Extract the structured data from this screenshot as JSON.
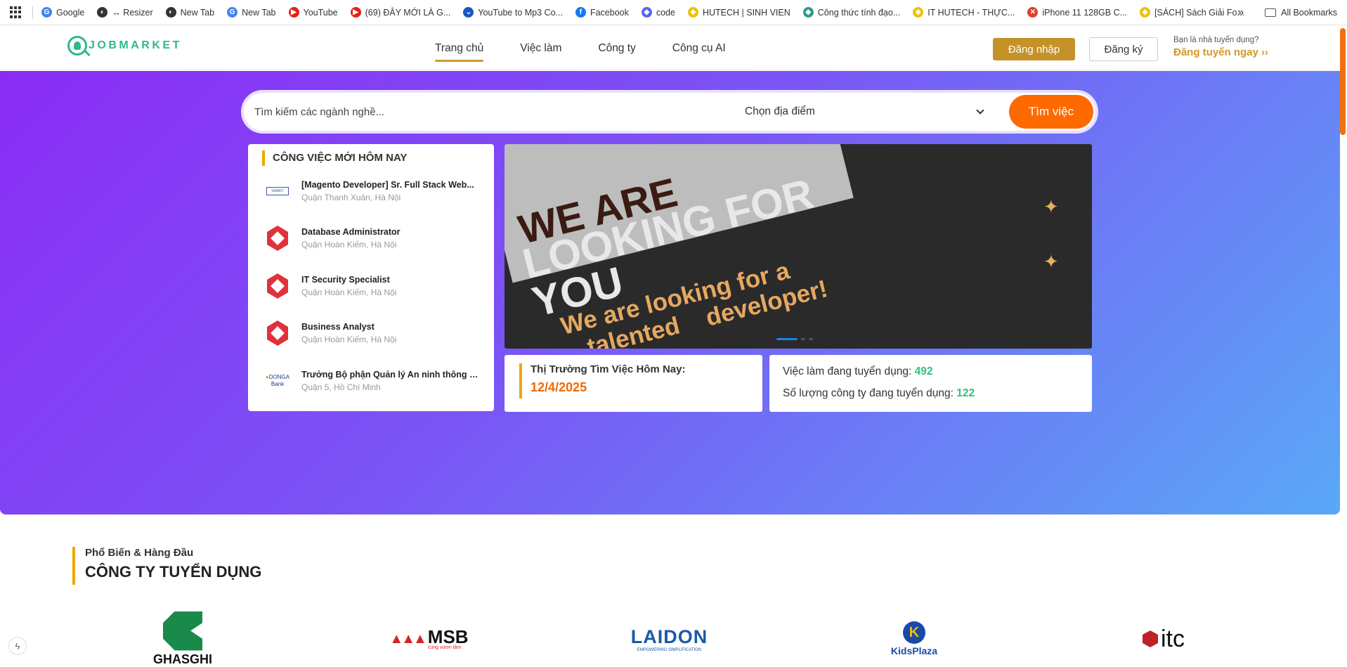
{
  "bookmarks": [
    {
      "label": "Google",
      "color": "#4285f4",
      "glyph": "G"
    },
    {
      "label": "↔ Resizer",
      "color": "#333",
      "glyph": "◐"
    },
    {
      "label": "New Tab",
      "color": "#333",
      "glyph": "◐"
    },
    {
      "label": "New Tab",
      "color": "#4285f4",
      "glyph": "G"
    },
    {
      "label": "YouTube",
      "color": "#e62117",
      "glyph": "▶"
    },
    {
      "label": "(69) ĐÂY MỚI LÀ G...",
      "color": "#e62117",
      "glyph": "▶"
    },
    {
      "label": "YouTube to Mp3 Co...",
      "color": "#1a56c4",
      "glyph": "⌄"
    },
    {
      "label": "Facebook",
      "color": "#1877f2",
      "glyph": "f"
    },
    {
      "label": "code",
      "color": "#5865f2",
      "glyph": "◆"
    },
    {
      "label": "HUTECH | SINH VIEN",
      "color": "#f0c000",
      "glyph": "◆"
    },
    {
      "label": "Công thức tính đạo...",
      "color": "#2a9d8f",
      "glyph": "◆"
    },
    {
      "label": "IT HUTECH - THỰC...",
      "color": "#f0c000",
      "glyph": "◆"
    },
    {
      "label": "iPhone 11 128GB C...",
      "color": "#e0402a",
      "glyph": "✕"
    },
    {
      "label": "[SÁCH] Sách Giải Fo...",
      "color": "#f0c000",
      "glyph": "◆"
    }
  ],
  "bookmarks_more": "»",
  "all_bookmarks": "All Bookmarks",
  "header": {
    "logo_text": "JOBMARKET",
    "nav": [
      {
        "label": "Trang chủ",
        "active": true
      },
      {
        "label": "Việc làm"
      },
      {
        "label": "Công ty"
      },
      {
        "label": "Công cụ AI"
      }
    ],
    "login": "Đăng nhập",
    "register": "Đăng ký",
    "recruiter_question": "Bạn là nhà tuyển dụng?",
    "recruiter_cta": "Đăng tuyển ngay",
    "recruiter_arrow": "››"
  },
  "search": {
    "placeholder": "Tìm kiếm các ngành nghề...",
    "location": "Chọn địa điểm",
    "button": "Tìm việc"
  },
  "today_jobs": {
    "title": "CÔNG VIỆC MỚI HÔM NAY",
    "items": [
      {
        "title": "[Magento Developer] Sr. Full Stack Web...",
        "location": "Quận Thanh Xuân, Hà Nội",
        "logo": "small-company"
      },
      {
        "title": "Database Administrator",
        "location": "Quận Hoàn Kiếm, Hà Nội",
        "logo": "hex"
      },
      {
        "title": "IT Security Specialist",
        "location": "Quận Hoàn Kiếm, Hà Nội",
        "logo": "hex"
      },
      {
        "title": "Business Analyst",
        "location": "Quận Hoàn Kiếm, Hà Nội",
        "logo": "hex"
      },
      {
        "title": "Trưởng Bộ phận Quản lý An ninh thông t...",
        "location": "Quận 5, Hồ Chí Minh",
        "logo": "donga"
      }
    ]
  },
  "banner": {
    "line1": "WE ARE",
    "line2": "LOOKING FOR",
    "line3": "YOU",
    "line4": "We are looking for a",
    "line5": "talented",
    "line6": "developer!",
    "slides_total": 3,
    "active_slide": 1
  },
  "market": {
    "label": "Thị Trường Tìm Việc Hôm Nay:",
    "date": "12/4/2025",
    "jobs_label": "Việc làm đang tuyển dụng:",
    "jobs_count": "492",
    "companies_label": "Số lượng công ty đang tuyển dụng:",
    "companies_count": "122"
  },
  "companies": {
    "subtitle": "Phổ Biến & Hàng Đầu",
    "title": "CÔNG TY TUYỂN DỤNG",
    "logos": [
      {
        "name": "GHASGHI",
        "color": "#1a8a4a"
      },
      {
        "name": "MSB",
        "tagline": "cùng vươn tầm",
        "color": "#d8232a"
      },
      {
        "name": "LAIDON",
        "tagline": "EMPOWERING SIMPLIFICATION",
        "color": "#1a5aa8"
      },
      {
        "name": "KidsPlaza",
        "color": "#1a4aa8"
      },
      {
        "name": "itc",
        "color": "#c0202a"
      }
    ]
  },
  "colors": {
    "accent": "#c5922a",
    "search_btn": "#ff6a00",
    "stat_value": "#2ec27e",
    "date": "#f06a00",
    "logo": "#2fb88c"
  }
}
